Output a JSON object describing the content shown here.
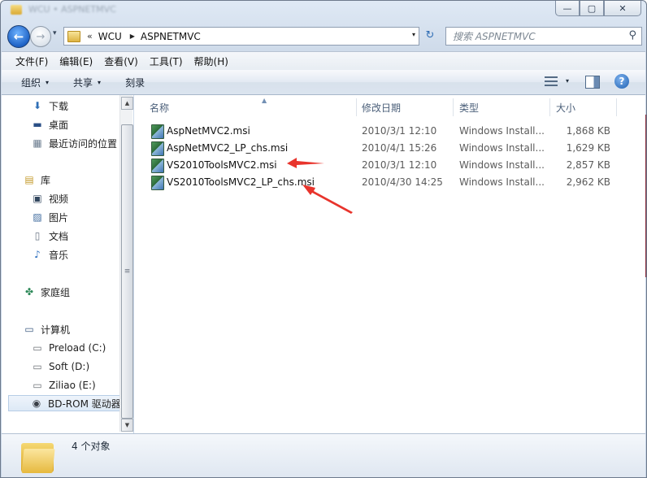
{
  "window": {
    "title": "WCU • ASPNETMVC",
    "controls": {
      "minimize": "—",
      "maximize": "▢",
      "close": "✕"
    }
  },
  "nav": {
    "back_icon": "←",
    "forward_icon": "→",
    "history_icon": "▾",
    "address": {
      "overflow": "«",
      "crumbs": [
        "WCU",
        "ASPNETMVC"
      ],
      "crumb_separator": "▶",
      "dropdown_icon": "▾"
    },
    "refresh_icon": "↻",
    "search": {
      "placeholder": "搜索 ASPNETMVC",
      "icon": "⚲"
    }
  },
  "menubar": {
    "items": [
      "文件(F)",
      "编辑(E)",
      "查看(V)",
      "工具(T)",
      "帮助(H)"
    ]
  },
  "toolbar": {
    "organize": "组织",
    "share": "共享",
    "burn": "刻录",
    "caret": "▾",
    "help": "?"
  },
  "sidebar": {
    "items": [
      {
        "label": "下载",
        "icon": "download-folder-icon",
        "glyph": "⬇"
      },
      {
        "label": "桌面",
        "icon": "desktop-icon",
        "glyph": "▬"
      },
      {
        "label": "最近访问的位置",
        "icon": "recent-places-icon",
        "glyph": "▦"
      },
      {
        "label": "库",
        "icon": "libraries-icon",
        "glyph": "▤"
      },
      {
        "label": "视频",
        "icon": "video-icon",
        "glyph": "▣"
      },
      {
        "label": "图片",
        "icon": "pictures-icon",
        "glyph": "▨"
      },
      {
        "label": "文档",
        "icon": "documents-icon",
        "glyph": "▯"
      },
      {
        "label": "音乐",
        "icon": "music-icon",
        "glyph": "♪"
      },
      {
        "label": "家庭组",
        "icon": "homegroup-icon",
        "glyph": "✤"
      },
      {
        "label": "计算机",
        "icon": "computer-icon",
        "glyph": "▭"
      },
      {
        "label": "Preload (C:)",
        "icon": "drive-c-icon",
        "glyph": "▭"
      },
      {
        "label": "Soft (D:)",
        "icon": "drive-d-icon",
        "glyph": "▭"
      },
      {
        "label": "Ziliao (E:)",
        "icon": "drive-e-icon",
        "glyph": "▭"
      },
      {
        "label": "BD-ROM 驱动器",
        "icon": "bd-rom-icon",
        "glyph": "◉"
      }
    ],
    "scroll_up": "▲",
    "scroll_down": "▼",
    "scroll_grip": "≡"
  },
  "columns": {
    "name": "名称",
    "date": "修改日期",
    "type": "类型",
    "size": "大小",
    "sort_indicator": "▲"
  },
  "files": [
    {
      "name": "AspNetMVC2.msi",
      "date": "2010/3/1 12:10",
      "type": "Windows Install...",
      "size": "1,868 KB"
    },
    {
      "name": "AspNetMVC2_LP_chs.msi",
      "date": "2010/4/1 15:26",
      "type": "Windows Install...",
      "size": "1,629 KB"
    },
    {
      "name": "VS2010ToolsMVC2.msi",
      "date": "2010/3/1 12:10",
      "type": "Windows Install...",
      "size": "2,857 KB"
    },
    {
      "name": "VS2010ToolsMVC2_LP_chs.msi",
      "date": "2010/4/30 14:25",
      "type": "Windows Install...",
      "size": "2,962 KB"
    }
  ],
  "status": {
    "count_text": "4 个对象"
  },
  "annotation_color": "#e8342c"
}
